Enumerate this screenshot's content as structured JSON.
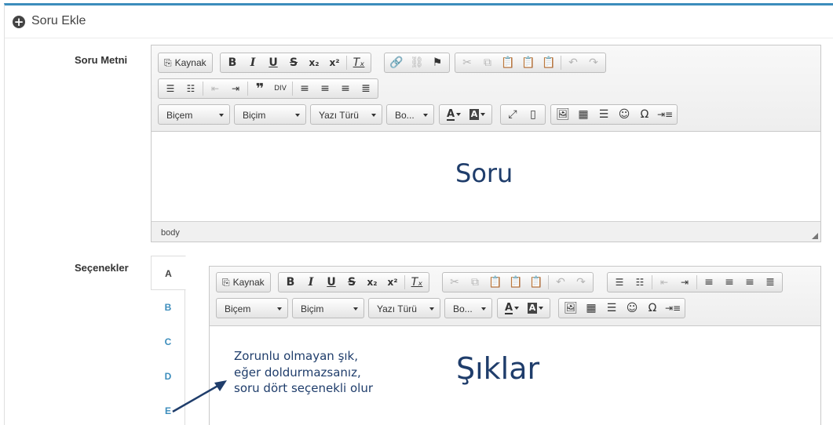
{
  "panel": {
    "title": "Soru Ekle",
    "icon": "plus-circle-icon",
    "accent_color": "#3c8dbc"
  },
  "question": {
    "label": "Soru Metni",
    "toolbar": {
      "source_label": "Kaynak",
      "format_label": "Biçem",
      "style_label": "Biçim",
      "font_label": "Yazı Türü",
      "size_label": "Bo..."
    },
    "content_text": "Soru",
    "status_path": "body"
  },
  "options": {
    "label": "Seçenekler",
    "tabs": [
      "A",
      "B",
      "C",
      "D",
      "E"
    ],
    "active_tab": "A",
    "toolbar": {
      "source_label": "Kaynak",
      "format_label": "Biçem",
      "style_label": "Biçim",
      "font_label": "Yazı Türü",
      "size_label": "Bo..."
    },
    "annotation": {
      "lines": [
        "Zorunlu olmayan şık,",
        "eğer doldurmazsanız,",
        "soru dört seçenekli olur"
      ],
      "heading": "Şıklar",
      "color": "#1f3d6b"
    }
  }
}
